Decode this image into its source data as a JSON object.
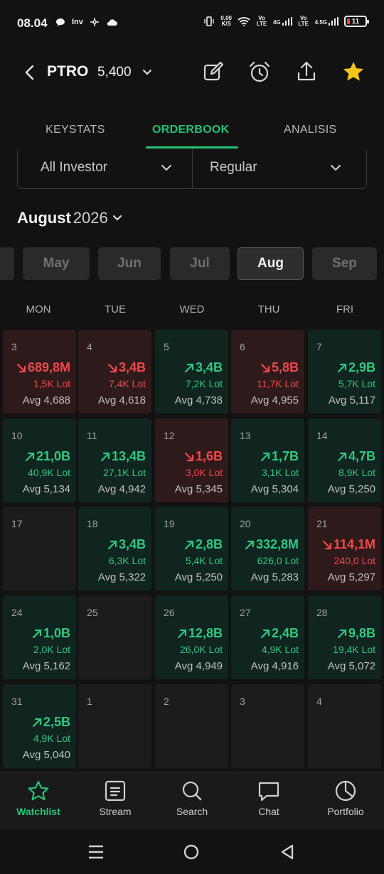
{
  "status_bar": {
    "time": "08.04",
    "left_icons": [
      "chat-bubble-icon",
      "inv-icon",
      "pinwheel-icon",
      "cloud-icon"
    ],
    "inv_label": "Inv",
    "speed_value": "0,00",
    "speed_unit": "K/S",
    "sim1_label": "Vo LTE",
    "sim1_net": "4G",
    "sim2_label": "Vo LTE",
    "sim2_net": "4.5G",
    "battery": "11"
  },
  "header": {
    "ticker": "PTRO",
    "price": "5,400"
  },
  "tabs": [
    {
      "label": "KEYSTATS",
      "active": false
    },
    {
      "label": "ORDERBOOK",
      "active": true
    },
    {
      "label": "ANALISIS",
      "active": false
    }
  ],
  "filters": {
    "investor": "All Investor",
    "market": "Regular"
  },
  "period": {
    "month": "August",
    "year": "2026"
  },
  "months": [
    {
      "label": "May",
      "active": false
    },
    {
      "label": "Jun",
      "active": false
    },
    {
      "label": "Jul",
      "active": false
    },
    {
      "label": "Aug",
      "active": true
    },
    {
      "label": "Sep",
      "active": false
    }
  ],
  "weekdays": [
    "MON",
    "TUE",
    "WED",
    "THU",
    "FRI"
  ],
  "calendar": [
    [
      {
        "day": "3",
        "trend": "down",
        "value": "689,8M",
        "lot": "1,5K Lot",
        "avg": "Avg 4,688"
      },
      {
        "day": "4",
        "trend": "down",
        "value": "3,4B",
        "lot": "7,4K Lot",
        "avg": "Avg 4,618"
      },
      {
        "day": "5",
        "trend": "up",
        "value": "3,4B",
        "lot": "7,2K Lot",
        "avg": "Avg 4,738"
      },
      {
        "day": "6",
        "trend": "down",
        "value": "5,8B",
        "lot": "11,7K Lot",
        "avg": "Avg 4,955"
      },
      {
        "day": "7",
        "trend": "up",
        "value": "2,9B",
        "lot": "5,7K Lot",
        "avg": "Avg 5,117"
      }
    ],
    [
      {
        "day": "10",
        "trend": "up",
        "value": "21,0B",
        "lot": "40,9K Lot",
        "avg": "Avg 5,134"
      },
      {
        "day": "11",
        "trend": "up",
        "value": "13,4B",
        "lot": "27,1K Lot",
        "avg": "Avg 4,942"
      },
      {
        "day": "12",
        "trend": "down",
        "value": "1,6B",
        "lot": "3,0K Lot",
        "avg": "Avg 5,345"
      },
      {
        "day": "13",
        "trend": "up",
        "value": "1,7B",
        "lot": "3,1K Lot",
        "avg": "Avg 5,304"
      },
      {
        "day": "14",
        "trend": "up",
        "value": "4,7B",
        "lot": "8,9K Lot",
        "avg": "Avg 5,250"
      }
    ],
    [
      {
        "day": "17",
        "trend": "none",
        "value": "",
        "lot": "",
        "avg": ""
      },
      {
        "day": "18",
        "trend": "up",
        "value": "3,4B",
        "lot": "6,3K Lot",
        "avg": "Avg 5,322"
      },
      {
        "day": "19",
        "trend": "up",
        "value": "2,8B",
        "lot": "5,4K Lot",
        "avg": "Avg 5,250"
      },
      {
        "day": "20",
        "trend": "up",
        "value": "332,8M",
        "lot": "626,0 Lot",
        "avg": "Avg 5,283"
      },
      {
        "day": "21",
        "trend": "down",
        "value": "114,1M",
        "lot": "240,0 Lot",
        "avg": "Avg 5,297"
      }
    ],
    [
      {
        "day": "24",
        "trend": "up",
        "value": "1,0B",
        "lot": "2,0K Lot",
        "avg": "Avg 5,162"
      },
      {
        "day": "25",
        "trend": "none",
        "value": "",
        "lot": "",
        "avg": ""
      },
      {
        "day": "26",
        "trend": "up",
        "value": "12,8B",
        "lot": "26,0K Lot",
        "avg": "Avg 4,949"
      },
      {
        "day": "27",
        "trend": "up",
        "value": "2,4B",
        "lot": "4,9K Lot",
        "avg": "Avg 4,916"
      },
      {
        "day": "28",
        "trend": "up",
        "value": "9,8B",
        "lot": "19,4K Lot",
        "avg": "Avg 5,072"
      }
    ],
    [
      {
        "day": "31",
        "trend": "up",
        "value": "2,5B",
        "lot": "4,9K Lot",
        "avg": "Avg 5,040"
      },
      {
        "day": "1",
        "trend": "none",
        "value": "",
        "lot": "",
        "avg": ""
      },
      {
        "day": "2",
        "trend": "none",
        "value": "",
        "lot": "",
        "avg": ""
      },
      {
        "day": "3",
        "trend": "none",
        "value": "",
        "lot": "",
        "avg": ""
      },
      {
        "day": "4",
        "trend": "none",
        "value": "",
        "lot": "",
        "avg": ""
      }
    ]
  ],
  "bottom_nav": [
    {
      "label": "Watchlist",
      "icon": "star-icon",
      "active": true
    },
    {
      "label": "Stream",
      "icon": "stream-icon",
      "active": false
    },
    {
      "label": "Search",
      "icon": "search-icon",
      "active": false
    },
    {
      "label": "Chat",
      "icon": "chat-icon",
      "active": false
    },
    {
      "label": "Portfolio",
      "icon": "pie-chart-icon",
      "active": false
    }
  ],
  "colors": {
    "accent": "#22c27a",
    "up": "#2fc686",
    "down": "#ef4a4a",
    "star": "#f5c518"
  }
}
